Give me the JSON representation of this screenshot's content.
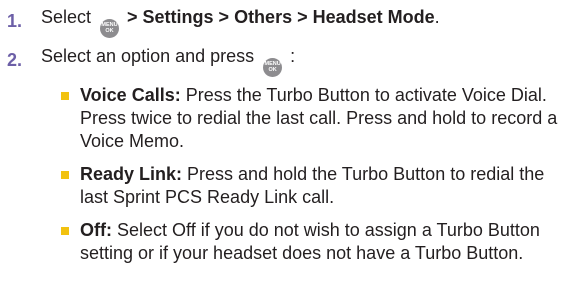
{
  "steps": [
    {
      "number": "1.",
      "before": "Select ",
      "icon": "menu-ok-icon",
      "icon_top": "MENU",
      "icon_bottom": "OK",
      "bold": " > Settings > Others > Headset Mode",
      "after": "."
    },
    {
      "number": "2.",
      "before": "Select an option and press ",
      "icon": "menu-ok-icon",
      "icon_top": "MENU",
      "icon_bottom": "OK",
      "after": " :"
    }
  ],
  "options": [
    {
      "label": "Voice Calls:",
      "text": " Press the Turbo Button to activate Voice Dial. Press twice to redial the last call. Press and hold to record a Voice Memo."
    },
    {
      "label": "Ready Link:",
      "text": " Press and hold the Turbo Button to redial the last Sprint PCS Ready Link call."
    },
    {
      "label": "Off:",
      "text": " Select Off if you do not wish to assign a Turbo Button setting or if your headset does not have a Turbo Button."
    }
  ],
  "colors": {
    "step_number": "#6c5fa7",
    "bullet": "#f2c20f",
    "menu_icon": "#8d8c8f"
  }
}
